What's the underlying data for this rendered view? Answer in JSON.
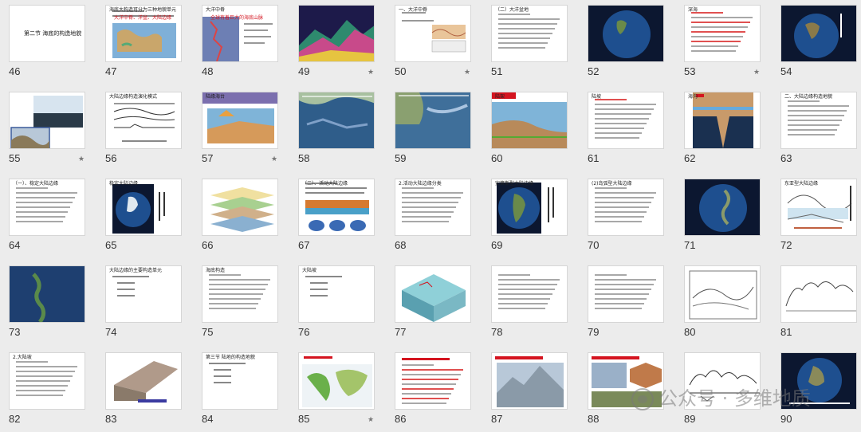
{
  "slides": [
    {
      "num": "46",
      "kind": "title",
      "text": "第二节  海底的构造地貌",
      "star": false
    },
    {
      "num": "47",
      "kind": "worldmap",
      "text": "海底大构造可分为三种地貌单元",
      "red": "大洋中脊、洋盆、大陆边缘",
      "star": false
    },
    {
      "num": "48",
      "kind": "ridge",
      "text": "大洋中脊",
      "red": "全球有着巨大的海底山脉",
      "star": false
    },
    {
      "num": "49",
      "kind": "relief3d",
      "text": "",
      "star": true
    },
    {
      "num": "50",
      "kind": "section",
      "text": "一、大洋中脊",
      "star": true
    },
    {
      "num": "51",
      "kind": "textlist",
      "text": "（二）大洋盆地",
      "star": false
    },
    {
      "num": "52",
      "kind": "globe",
      "text": "",
      "star": false
    },
    {
      "num": "53",
      "kind": "redlist",
      "text": "深海",
      "star": true
    },
    {
      "num": "54",
      "kind": "globe2",
      "text": "",
      "star": false
    },
    {
      "num": "55",
      "kind": "photo",
      "text": "",
      "star": true
    },
    {
      "num": "56",
      "kind": "profiles",
      "text": "大陆边缘构造演化模式",
      "star": false
    },
    {
      "num": "57",
      "kind": "block",
      "text": "陆缘海台",
      "star": true
    },
    {
      "num": "58",
      "kind": "seafloor",
      "text": "",
      "star": false
    },
    {
      "num": "59",
      "kind": "seafloor2",
      "text": "",
      "star": false
    },
    {
      "num": "60",
      "kind": "shelf",
      "text": "陆架",
      "star": false
    },
    {
      "num": "61",
      "kind": "redlist2",
      "text": "陆坡",
      "star": false
    },
    {
      "num": "62",
      "kind": "canyon",
      "text": "海沟",
      "star": false
    },
    {
      "num": "63",
      "kind": "textlist",
      "text": "二、大陆边缘构造地貌",
      "star": false
    },
    {
      "num": "64",
      "kind": "textlist",
      "text": "（一）、稳定大陆边缘",
      "star": false
    },
    {
      "num": "65",
      "kind": "globe3",
      "text": "稳定大陆边缘",
      "star": false
    },
    {
      "num": "66",
      "kind": "layers",
      "text": "",
      "star": false
    },
    {
      "num": "67",
      "kind": "plates",
      "text": "（二）、活动大陆边缘",
      "star": false
    },
    {
      "num": "68",
      "kind": "textlist",
      "text": "2.活动大陆边缘分类",
      "star": false
    },
    {
      "num": "69",
      "kind": "samerica",
      "text": "安第斯型大陆边缘",
      "star": false
    },
    {
      "num": "70",
      "kind": "textlist",
      "text": "(2)岛弧型大陆边缘",
      "star": false
    },
    {
      "num": "71",
      "kind": "globe4",
      "text": "",
      "star": false
    },
    {
      "num": "72",
      "kind": "arcdiag",
      "text": "东亚型大陆边缘",
      "star": false
    },
    {
      "num": "73",
      "kind": "islands",
      "text": "",
      "star": false
    },
    {
      "num": "74",
      "kind": "bullets",
      "text": "大陆边缘的主要构造单元",
      "star": false
    },
    {
      "num": "75",
      "kind": "textlist",
      "text": "海底构造",
      "star": false
    },
    {
      "num": "76",
      "kind": "bullets",
      "text": "大陆坡",
      "star": false
    },
    {
      "num": "77",
      "kind": "tealblock",
      "text": "",
      "star": false
    },
    {
      "num": "78",
      "kind": "textlist",
      "text": "",
      "star": false
    },
    {
      "num": "79",
      "kind": "textlist",
      "text": "",
      "star": false
    },
    {
      "num": "80",
      "kind": "sketch",
      "text": "",
      "star": false
    },
    {
      "num": "81",
      "kind": "sketch2",
      "text": "",
      "star": false
    },
    {
      "num": "82",
      "kind": "textlist",
      "text": "2.大陆坡",
      "star": false
    },
    {
      "num": "83",
      "kind": "block3d",
      "text": "",
      "star": false
    },
    {
      "num": "84",
      "kind": "bullets",
      "text": "第三节  陆地的构造地貌",
      "star": false
    },
    {
      "num": "85",
      "kind": "worldmap2",
      "text": "",
      "star": true
    },
    {
      "num": "86",
      "kind": "redlist3",
      "text": "",
      "star": false
    },
    {
      "num": "87",
      "kind": "mountain",
      "text": "",
      "star": false
    },
    {
      "num": "88",
      "kind": "mountain2",
      "text": "",
      "star": false
    },
    {
      "num": "89",
      "kind": "sketch3",
      "text": "",
      "star": false
    },
    {
      "num": "90",
      "kind": "globe5",
      "text": "",
      "star": false
    }
  ],
  "watermark": "公众号 · 多维地质"
}
